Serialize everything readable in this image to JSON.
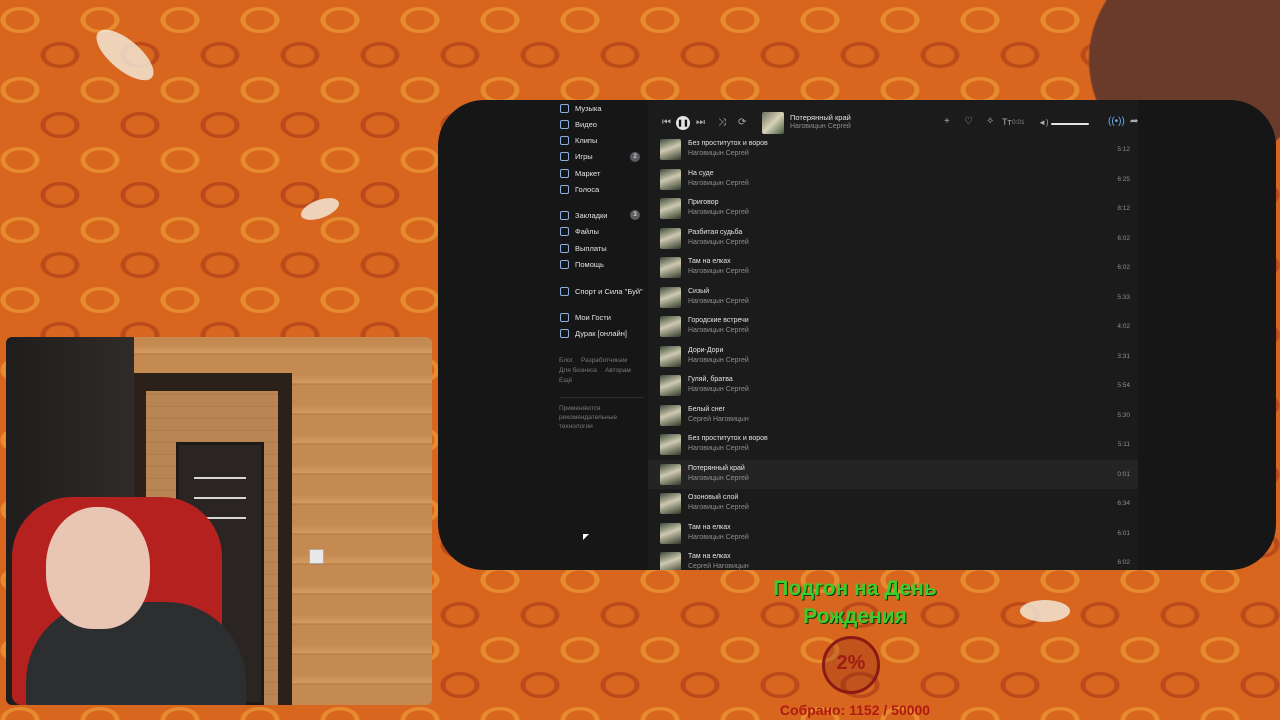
{
  "sidebar": {
    "items": [
      {
        "label": "Музыка",
        "icon": "music-icon"
      },
      {
        "label": "Видео",
        "icon": "video-icon"
      },
      {
        "label": "Клипы",
        "icon": "clips-icon"
      },
      {
        "label": "Игры",
        "icon": "games-icon",
        "badge": "2"
      },
      {
        "label": "Маркет",
        "icon": "market-icon"
      },
      {
        "label": "Голоса",
        "icon": "votes-icon"
      },
      {
        "label": "Закладки",
        "icon": "bookmark-icon",
        "badge": "3"
      },
      {
        "label": "Файлы",
        "icon": "files-icon"
      },
      {
        "label": "Выплаты",
        "icon": "payouts-icon"
      },
      {
        "label": "Помощь",
        "icon": "help-icon"
      },
      {
        "label": "Спорт и Сила \"Буй\"",
        "icon": "group-icon"
      },
      {
        "label": "Мои Гости",
        "icon": "app-icon"
      },
      {
        "label": "Дурак [онлайн]",
        "icon": "gamepad-icon"
      }
    ],
    "footer_links": [
      "Блог",
      "Разработчикам",
      "Для бизнеса",
      "Авторам",
      "Ещё"
    ],
    "recommend_note": [
      "Применяются",
      "рекомендательные",
      "технологии"
    ]
  },
  "player": {
    "title": "Потерянный край",
    "artist": "Наговицын Сергей",
    "time": "0:01"
  },
  "tracks": [
    {
      "title": "Без проститутох и воров",
      "artist": "Наговицын Сергей",
      "duration": "5:12"
    },
    {
      "title": "На суде",
      "artist": "Наговицын Сергей",
      "duration": "6:25"
    },
    {
      "title": "Приговор",
      "artist": "Наговицын Сергей",
      "duration": "8:12"
    },
    {
      "title": "Разбитая судьба",
      "artist": "Наговицын Сергей",
      "duration": "6:02"
    },
    {
      "title": "Там на елках",
      "artist": "Наговицын Сергей",
      "duration": "6:02"
    },
    {
      "title": "Сизый",
      "artist": "Наговицын Сергей",
      "duration": "5:33"
    },
    {
      "title": "Городские встречи",
      "artist": "Наговицын Сергей",
      "duration": "4:02"
    },
    {
      "title": "Дори-Дори",
      "artist": "Наговицын Сергей",
      "duration": "3:31"
    },
    {
      "title": "Гуляй, братва",
      "artist": "Наговицын Сергей",
      "duration": "5:54"
    },
    {
      "title": "Белый снег",
      "artist": "Сергей Наговицын",
      "duration": "5:30"
    },
    {
      "title": "Без проститутох и воров",
      "artist": "Наговицын Сергей",
      "duration": "5:11"
    },
    {
      "title": "Потерянный край",
      "artist": "Наговицын Сергей",
      "duration": "0:01",
      "active": true
    },
    {
      "title": "Озоновый слой",
      "artist": "Наговицын Сергей",
      "duration": "6:34"
    },
    {
      "title": "Там на елках",
      "artist": "Наговицын Сергей",
      "duration": "6:01"
    },
    {
      "title": "Там на елках",
      "artist": "Сергей Наговицын",
      "duration": "6:02"
    }
  ],
  "goal": {
    "title": "Подгон на День Рождения",
    "percent": "2%",
    "collected": "Собрано: 1152 / 50000"
  },
  "colors": {
    "accent_green": "#3dcc2b",
    "goal_red": "#a01d15",
    "app_bg": "#1b1b1c"
  }
}
